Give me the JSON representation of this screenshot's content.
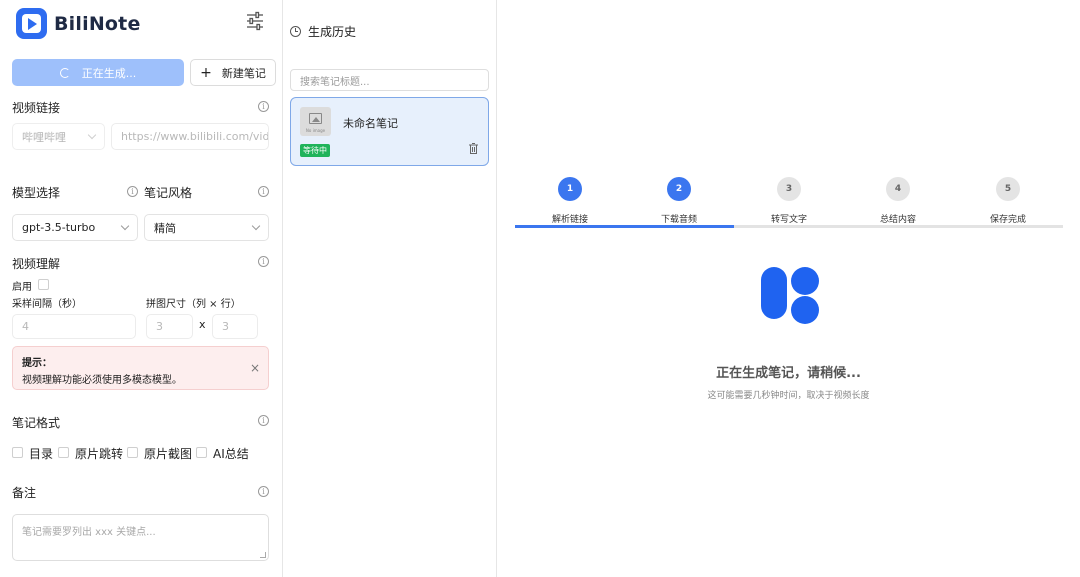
{
  "app": {
    "name": "BiliNote"
  },
  "sidebar": {
    "generate_button": "正在生成...",
    "new_note_button": "新建笔记",
    "video_link_label": "视频链接",
    "platform_select": "哔哩哔哩",
    "url_placeholder": "https://www.bilibili.com/video/...",
    "model_label": "模型选择",
    "style_label": "笔记风格",
    "model_value": "gpt-3.5-turbo",
    "style_value": "精简",
    "video_understanding_label": "视频理解",
    "enable_label": "启用",
    "interval_label": "采样间隔（秒）",
    "grid_label": "拼图尺寸（列 × 行）",
    "interval_value": "4",
    "grid_cols": "3",
    "grid_x": "x",
    "grid_rows": "3",
    "alert_title": "提示：",
    "alert_text": "视频理解功能必须使用多模态模型。",
    "alert_close": "×",
    "format_label": "笔记格式",
    "format_options": [
      "目录",
      "原片跳转",
      "原片截图",
      "AI总结"
    ],
    "notes_label": "备注",
    "notes_placeholder": "笔记需要罗列出 xxx 关键点..."
  },
  "history": {
    "title": "生成历史",
    "search_placeholder": "搜索笔记标题...",
    "card_title": "未命名笔记",
    "card_status": "等待中",
    "thumb_caption": "No image"
  },
  "main": {
    "steps": [
      {
        "number": "1",
        "label": "解析链接",
        "state": "active"
      },
      {
        "number": "2",
        "label": "下载音频",
        "state": "active"
      },
      {
        "number": "3",
        "label": "转写文字",
        "state": "idle"
      },
      {
        "number": "4",
        "label": "总结内容",
        "state": "idle"
      },
      {
        "number": "5",
        "label": "保存完成",
        "state": "idle"
      }
    ],
    "progress_fraction": 0.4,
    "status_title": "正在生成笔记，请稍候...",
    "status_sub": "这可能需要几秒钟时间，取决于视频长度"
  },
  "colors": {
    "accent": "#3b76ef",
    "brand": "#2e6cf0",
    "success": "#20b35a"
  }
}
